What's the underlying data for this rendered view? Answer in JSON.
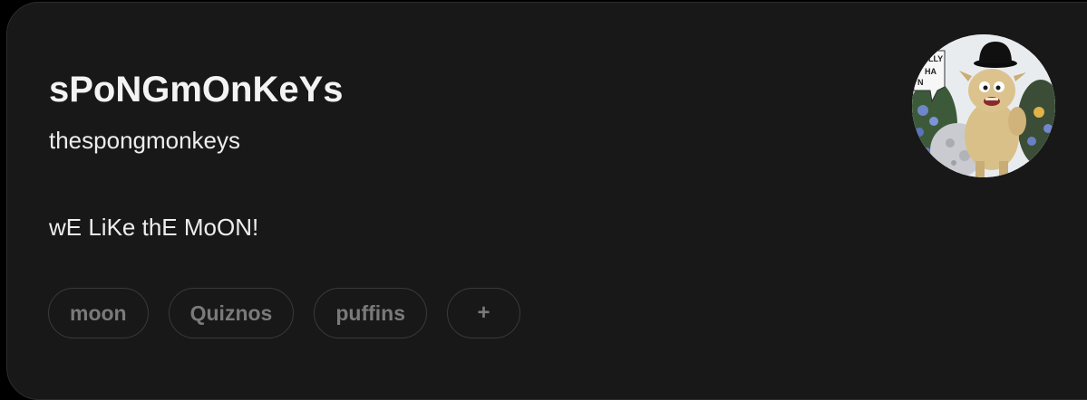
{
  "profile": {
    "display_name": "sPoNGmOnKeYs",
    "username": "thespongmonkeys",
    "bio": "wE LiKe thE MoON!",
    "avatar_sign_text": [
      "LLY",
      "HA",
      "N"
    ]
  },
  "tags": [
    {
      "label": "moon"
    },
    {
      "label": "Quiznos"
    },
    {
      "label": "puffins"
    }
  ],
  "add_tag": {
    "label": "+"
  },
  "colors": {
    "page_background": "#000000",
    "card_background": "#181818",
    "primary_text": "#f3f3f3",
    "tag_text": "#7a7a7a",
    "tag_border": "#3a3a3a"
  }
}
